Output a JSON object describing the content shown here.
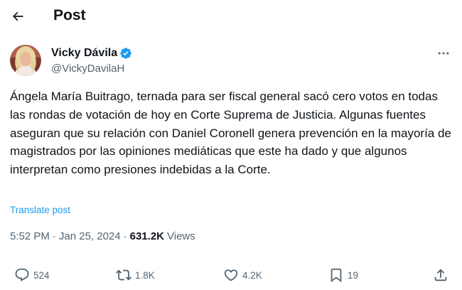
{
  "header": {
    "title": "Post"
  },
  "author": {
    "display_name": "Vicky Dávila",
    "handle": "@VickyDavilaH",
    "verified": true
  },
  "tweet": {
    "text": "Ángela María Buitrago, ternada para ser fiscal general sacó cero votos en todas las rondas de votación de hoy en Corte Suprema de Justicia. Algunas fuentes aseguran que su relación con Daniel Coronell genera prevención en la mayoría de magistrados por las opiniones mediáticas que este ha dado y que algunos interpretan como presiones indebidas a la Corte.",
    "translate_label": "Translate post",
    "time": "5:52 PM",
    "separator": "·",
    "date": "Jan 25, 2024",
    "views_count": "631.2K",
    "views_label": "Views"
  },
  "actions": {
    "replies": "524",
    "reposts": "1.8K",
    "likes": "4.2K",
    "bookmarks": "19"
  },
  "colors": {
    "accent": "#1d9bf0",
    "text_primary": "#0f1419",
    "text_secondary": "#536471"
  },
  "icons": [
    "back-arrow-icon",
    "verified-badge-icon",
    "more-options-icon",
    "reply-icon",
    "repost-icon",
    "like-icon",
    "bookmark-icon",
    "share-icon"
  ]
}
